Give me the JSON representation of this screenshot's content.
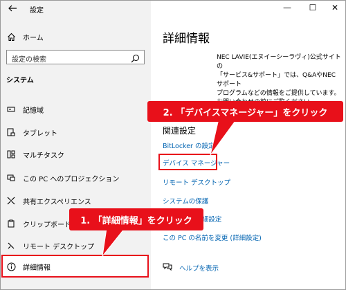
{
  "window": {
    "title": "設定",
    "controls": {
      "minimize": "—",
      "maximize": "☐",
      "close": "✕"
    }
  },
  "sidebar": {
    "home_label": "ホーム",
    "search_placeholder": "設定の検索",
    "section_title": "システム",
    "items": [
      {
        "label": "記憶域",
        "icon": "storage-icon"
      },
      {
        "label": "タブレット",
        "icon": "tablet-icon"
      },
      {
        "label": "マルチタスク",
        "icon": "multitask-icon"
      },
      {
        "label": "この PC へのプロジェクション",
        "icon": "projection-icon"
      },
      {
        "label": "共有エクスペリエンス",
        "icon": "shared-experience-icon"
      },
      {
        "label": "クリップボード",
        "icon": "clipboard-icon"
      },
      {
        "label": "リモート デスクトップ",
        "icon": "remote-desktop-icon"
      },
      {
        "label": "詳細情報",
        "icon": "info-icon",
        "selected": true
      }
    ]
  },
  "main": {
    "title": "詳細情報",
    "info_lines": [
      "NEC LAVIE(エヌイーシーラヴィ)公式サイトの",
      "「サービス&サポート」では、Q&AやNECサポート",
      "プログラムなどの情報をご提供しています。",
      "お問い合わせの前にご覧ください。"
    ],
    "related_title": "関連設定",
    "links": [
      "BitLocker の設定",
      "デバイス マネージャー",
      "リモート デスクトップ",
      "システムの保護",
      "システムの詳細設定",
      "この PC の名前を変更 (詳細設定)"
    ],
    "help_label": "ヘルプを表示"
  },
  "annotations": {
    "step1": "1. 「詳細情報」をクリック",
    "step2": "2. 「デバイスマネージャー」をクリック",
    "color": "#e8101a"
  }
}
